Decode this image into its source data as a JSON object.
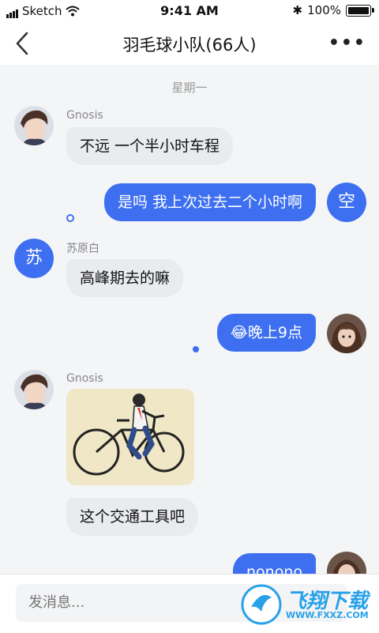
{
  "status": {
    "carrier": "Sketch",
    "time": "9:41 AM",
    "battery": "100%"
  },
  "nav": {
    "title": "羽毛球小队(66人)",
    "more": "•••"
  },
  "day_label": "星期一",
  "messages": [
    {
      "sender": "Gnosis",
      "text": "不远 一个半小时车程"
    },
    {
      "sender_avatar": "空",
      "text": "是吗 我上次过去二个小时啊"
    },
    {
      "sender": "苏原白",
      "avatar": "苏",
      "text": "高峰期去的嘛"
    },
    {
      "text": "😂晚上9点"
    },
    {
      "sender": "Gnosis",
      "image": "bicycle-picture"
    },
    {
      "text": "这个交通工具吧"
    },
    {
      "text": "nonono"
    }
  ],
  "input": {
    "placeholder": "发消息..."
  },
  "watermark": {
    "brand": "飞翔下载",
    "url": "WWW.FXXZ.COM"
  },
  "colors": {
    "accent": "#3d6ff0",
    "incoming_bubble": "#e9ebef",
    "background": "#f4f5f7"
  }
}
